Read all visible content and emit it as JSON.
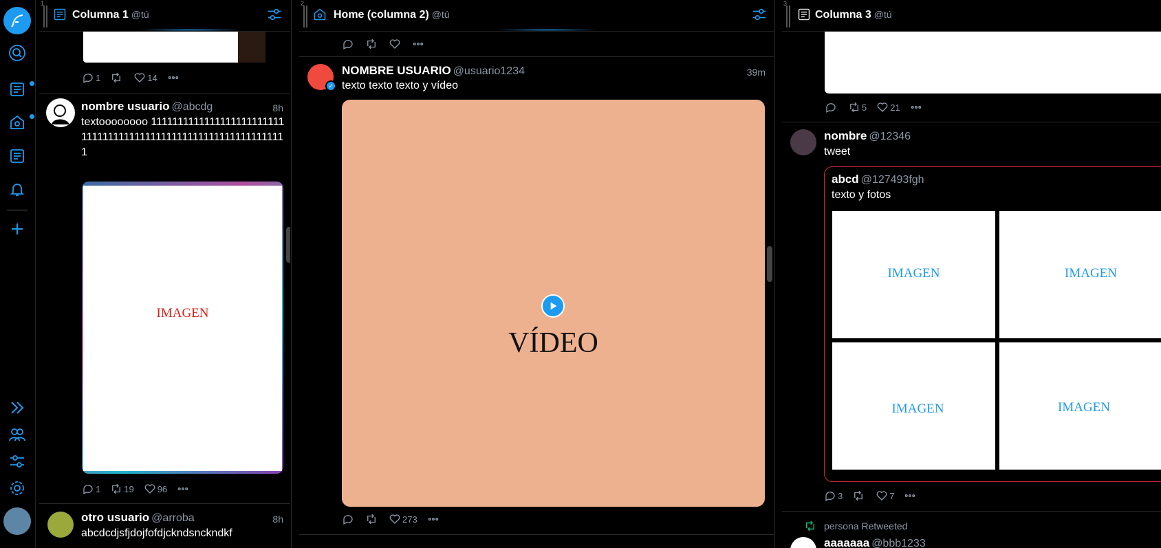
{
  "colors": {
    "accent": "#1d9bf0",
    "muted": "#8b98a5",
    "image_label_red": "#e0201a",
    "image_label_blue": "#1d9bf0",
    "video_bg": "#eeb190",
    "quote_border": "#d0263d",
    "retweet_green": "#00ba7c"
  },
  "nav": {
    "icons": [
      "compose-icon",
      "search-icon",
      "column-list-icon",
      "home-icon",
      "column-list-icon",
      "bell-icon",
      "plus-icon",
      "expand-icon",
      "accounts-icon",
      "filters-icon",
      "settings-icon"
    ]
  },
  "columns": [
    {
      "number": "1",
      "title": "Columna 1",
      "account": "@tú"
    },
    {
      "number": "2",
      "title": "Home (columna 2)",
      "account": "@tú"
    },
    {
      "number": "3",
      "title": "Columna 3",
      "account": "@tú"
    }
  ],
  "col1": {
    "top_actions": {
      "replies": "1",
      "retweets": "",
      "likes": "14"
    },
    "tweet1": {
      "name": "nombre usuario",
      "handle": "@abcdg",
      "time": "8h",
      "text": "textoooooooo 1111111111111111111111111111111111111111111111111111111111111111",
      "image_label": "IMAGEN",
      "actions": {
        "replies": "1",
        "retweets": "19",
        "likes": "96"
      }
    },
    "tweet2": {
      "name": "otro usuario",
      "handle": "@arroba",
      "time": "8h",
      "text": "abcdcdjsfjdojfofdjckndsnckndkf"
    }
  },
  "col2": {
    "tweet1": {
      "name": "NOMBRE USUARIO",
      "handle": "@usuario1234",
      "time": "39m",
      "text": "texto texto texto y vídeo",
      "video_label": "VÍDEO",
      "actions": {
        "replies": "",
        "retweets": "",
        "likes": "273"
      }
    }
  },
  "col3": {
    "top_actions": {
      "replies": "",
      "retweets": "5",
      "likes": "21"
    },
    "tweet1": {
      "name": "nombre",
      "handle": "@12346",
      "text": "tweet",
      "quote": {
        "name": "abcd",
        "handle": "@127493fgh",
        "text": "texto y fotos",
        "images": [
          "IMAGEN",
          "IMAGEN",
          "IMAGEN",
          "IMAGEN"
        ]
      },
      "actions": {
        "replies": "3",
        "retweets": "",
        "likes": "7"
      }
    },
    "retweet": {
      "retweeted_by": "persona Retweeted",
      "name": "aaaaaaa",
      "handle": "@bbb1233"
    }
  }
}
